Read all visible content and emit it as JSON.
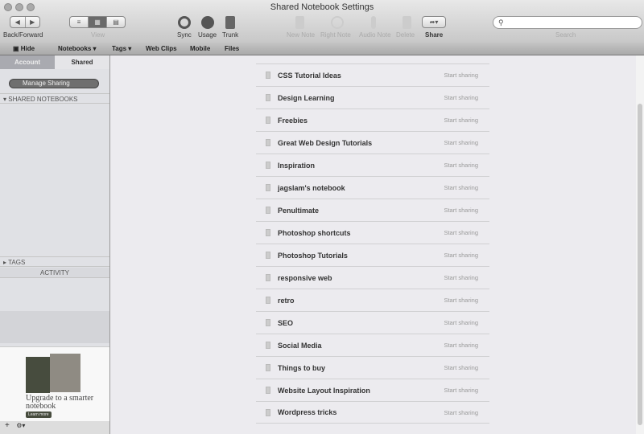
{
  "window": {
    "title": "Shared Notebook Settings"
  },
  "toolbar": {
    "back_forward": "Back/Forward",
    "view": "View",
    "sync": "Sync",
    "usage": "Usage",
    "trunk": "Trunk",
    "new_note": "New Note",
    "right_note": "Right Note",
    "audio_note": "Audio Note",
    "delete": "Delete",
    "share": "Share",
    "search": "Search",
    "search_placeholder": ""
  },
  "navbar": {
    "hide": "Hide",
    "notebooks": "Notebooks ▾",
    "tags": "Tags ▾",
    "web_clips": "Web Clips",
    "mobile": "Mobile",
    "files": "Files"
  },
  "sidebar": {
    "tabs": [
      "Account",
      "Shared"
    ],
    "manage_sharing": "Manage Sharing",
    "shared_notebooks": "SHARED NOTEBOOKS",
    "tags": "TAGS",
    "activity": "ACTIVITY",
    "promo": {
      "text": "Upgrade to a smarter notebook",
      "button": "Learn more"
    },
    "add": "+",
    "gear": "⚙▾"
  },
  "notebooks": [
    {
      "name": "CSS Tutorial Ideas",
      "action": "Start sharing"
    },
    {
      "name": "Design Learning",
      "action": "Start sharing"
    },
    {
      "name": "Freebies",
      "action": "Start sharing"
    },
    {
      "name": "Great Web Design Tutorials",
      "action": "Start sharing"
    },
    {
      "name": "Inspiration",
      "action": "Start sharing"
    },
    {
      "name": "jagslam's notebook",
      "action": "Start sharing"
    },
    {
      "name": "Penultimate",
      "action": "Start sharing"
    },
    {
      "name": "Photoshop shortcuts",
      "action": "Start sharing"
    },
    {
      "name": "Photoshop Tutorials",
      "action": "Start sharing"
    },
    {
      "name": "responsive web",
      "action": "Start sharing"
    },
    {
      "name": "retro",
      "action": "Start sharing"
    },
    {
      "name": "SEO",
      "action": "Start sharing"
    },
    {
      "name": "Social Media",
      "action": "Start sharing"
    },
    {
      "name": "Things to buy",
      "action": "Start sharing"
    },
    {
      "name": "Website Layout Inspiration",
      "action": "Start sharing"
    },
    {
      "name": "Wordpress tricks",
      "action": "Start sharing"
    }
  ]
}
